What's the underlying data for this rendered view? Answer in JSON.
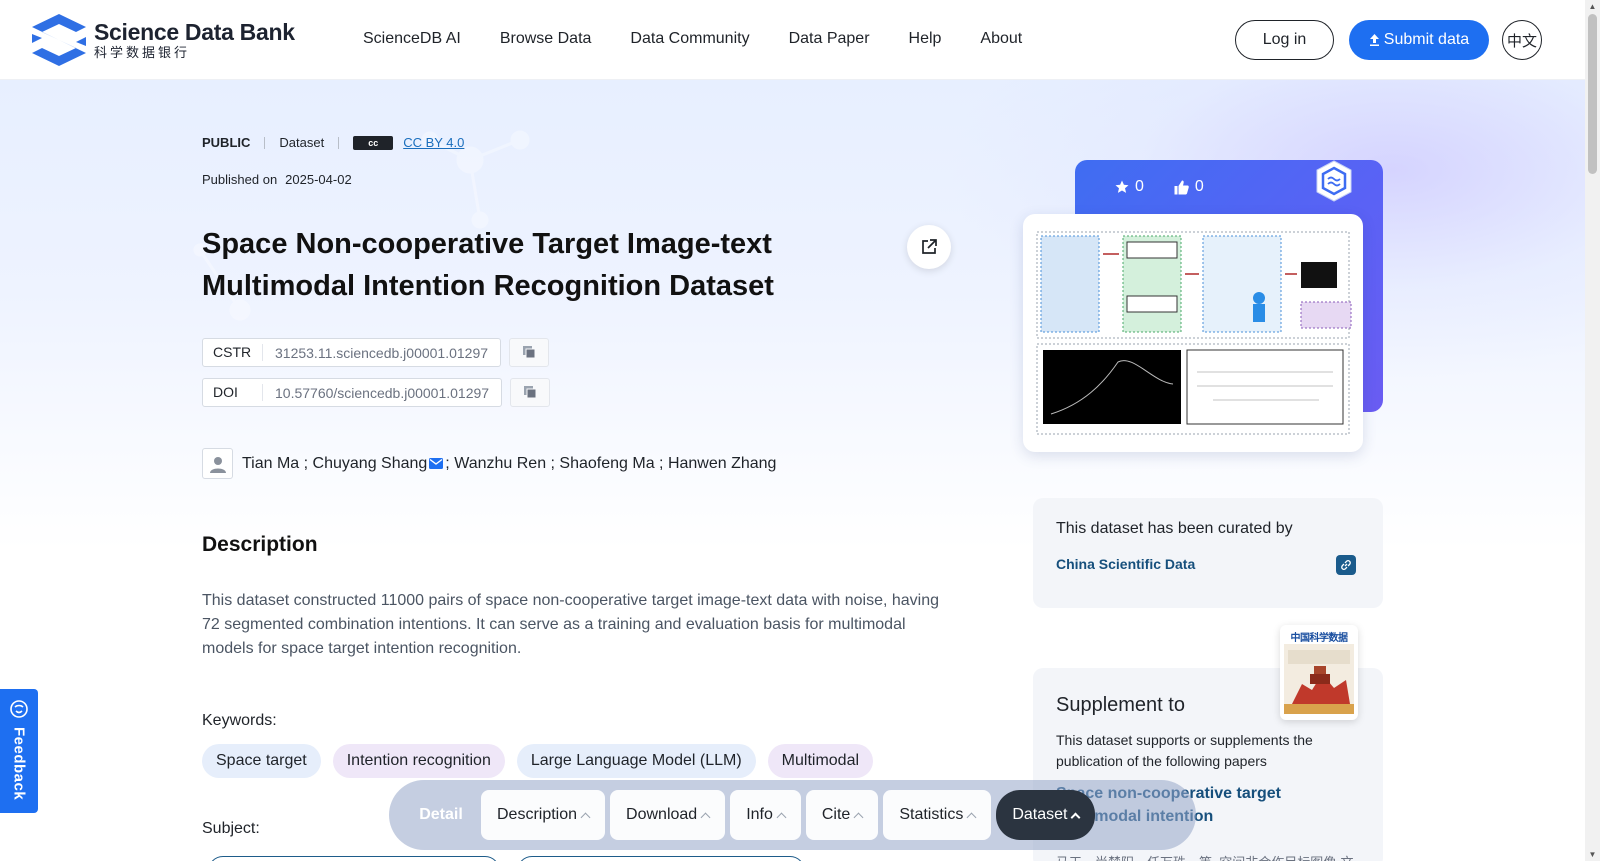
{
  "header": {
    "logo_en": "Science Data Bank",
    "logo_cn": "科学数据银行",
    "nav": [
      "ScienceDB AI",
      "Browse Data",
      "Data Community",
      "Data Paper",
      "Help",
      "About"
    ],
    "login_label": "Log in",
    "submit_label": "Submit data",
    "lang_label": "中文"
  },
  "dataset": {
    "visibility": "PUBLIC",
    "type": "Dataset",
    "license_badge": "cc",
    "license": "CC BY 4.0",
    "published_label": "Published on",
    "published_date": "2025-04-02",
    "title": "Space Non-cooperative Target Image-text Multimodal Intention Recognition Dataset",
    "cstr_label": "CSTR",
    "cstr_value": "31253.11.sciencedb.j00001.01297",
    "doi_label": "DOI",
    "doi_value": "10.57760/sciencedb.j00001.01297",
    "authors_before": "Tian Ma ; Chuyang Shang",
    "authors_after": "; Wanzhu Ren ; Shaofeng Ma ; Hanwen Zhang"
  },
  "description": {
    "heading": "Description",
    "text": "This dataset constructed 11000 pairs of space non-cooperative target image-text data with noise, having 72 segmented combination intentions. It can serve as a training and evaluation basis for multimodal models for space target intention recognition."
  },
  "keywords": {
    "label": "Keywords:",
    "items": [
      "Space target",
      "Intention recognition",
      "Large Language Model (LLM)",
      "Multimodal"
    ]
  },
  "subject": {
    "label": "Subject:"
  },
  "sidebar": {
    "stars": "0",
    "likes": "0",
    "curated_text": "This dataset has been curated by",
    "curated_org": "China Scientific Data",
    "supplement_title": "Supplement to",
    "supplement_text": "This dataset supports or supplements the publication of the following papers",
    "paper_title": "Space non-cooperative target multimodal intention",
    "paper_authors": "马天，尚楚阳，任万珠，等. 空间非合作目标图像-文",
    "journal_title": "中国科学数据"
  },
  "feedback_label": "Feedback",
  "tabbar": {
    "detail": "Detail",
    "tabs": [
      "Description",
      "Download",
      "Info",
      "Cite",
      "Statistics",
      "Dataset"
    ]
  },
  "colors": {
    "accent": "#1e6ff1",
    "link": "#164f7c",
    "tab_active": "#2b3440"
  }
}
